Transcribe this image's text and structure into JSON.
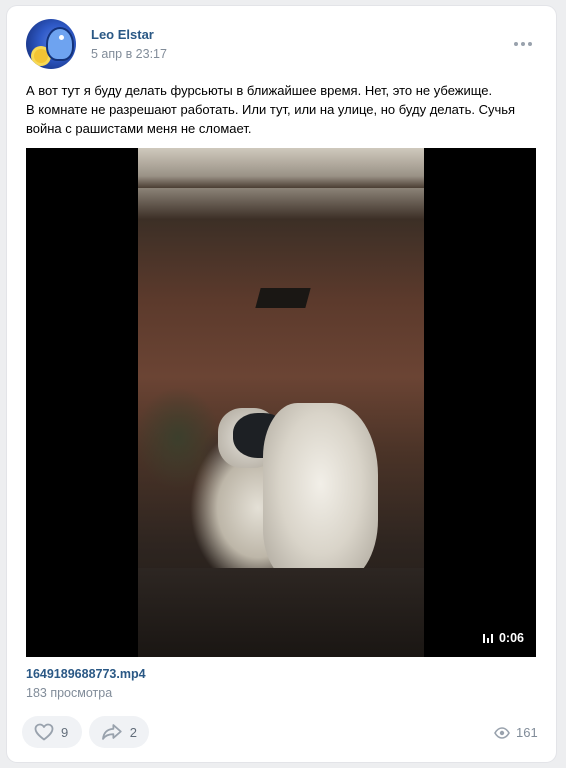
{
  "post": {
    "author": "Leo Elstar",
    "date": "5 апр в 23:17",
    "more_icon": "more-horizontal-icon",
    "text_lines": [
      "А вот тут я буду делать фурсьюты в ближайшее время. Нет, это не убежище.",
      "В комнате не разрешают работать. Или тут, или на улице, но буду делать. Сучья",
      "война с рашистами меня не сломает."
    ]
  },
  "video": {
    "duration": "0:06",
    "filename": "1649189688773.mp4",
    "views": "183 просмотра"
  },
  "actions": {
    "likes": "9",
    "shares": "2",
    "views": "161"
  },
  "colors": {
    "link": "#2a5885",
    "secondary": "#818c99",
    "background": "#edeef0",
    "button_bg": "#f0f2f5"
  }
}
